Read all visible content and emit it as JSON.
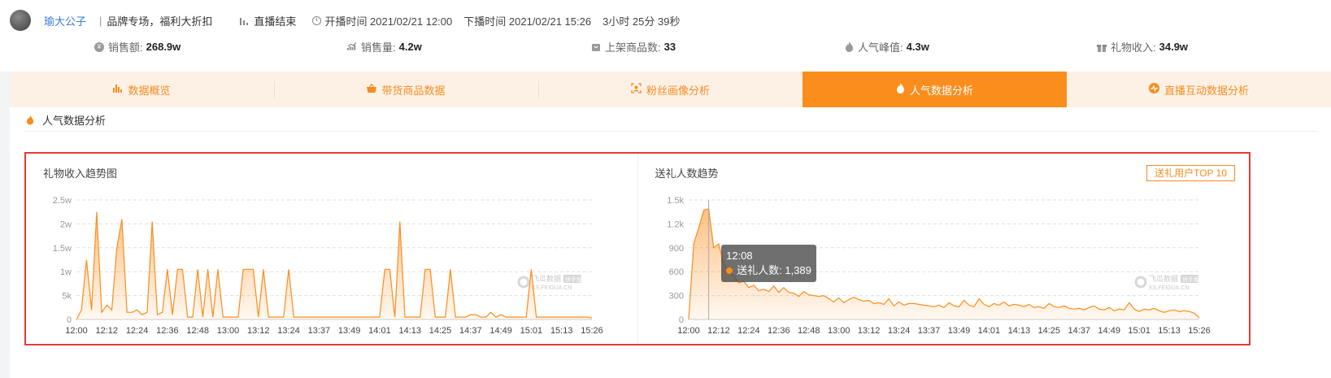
{
  "header": {
    "streamer_name": "瑜大公子",
    "title": "品牌专场，福利大折扣",
    "status": "直播结束",
    "start_label": "开播时间 2021/02/21 12:00",
    "end_label": "下播时间 2021/02/21 15:26",
    "duration": "3小时 25分 39秒"
  },
  "stats": [
    {
      "icon": "coin-icon",
      "label": "销售额:",
      "value": "268.9w"
    },
    {
      "icon": "trend-icon",
      "label": "销售量:",
      "value": "4.2w"
    },
    {
      "icon": "shop-bag-icon",
      "label": "上架商品数:",
      "value": "33"
    },
    {
      "icon": "flame-icon",
      "label": "人气峰值:",
      "value": "4.3w"
    },
    {
      "icon": "gift-icon",
      "label": "礼物收入:",
      "value": "34.9w"
    }
  ],
  "tabs": [
    {
      "icon": "bar-chart-icon",
      "label": "数据概览",
      "active": false
    },
    {
      "icon": "basket-icon",
      "label": "带货商品数据",
      "active": false
    },
    {
      "icon": "user-frame-icon",
      "label": "粉丝画像分析",
      "active": false
    },
    {
      "icon": "flame-icon",
      "label": "人气数据分析",
      "active": true
    },
    {
      "icon": "pulse-icon",
      "label": "直播互动数据分析",
      "active": false
    }
  ],
  "section_title": "人气数据分析",
  "colors": {
    "accent": "#fb8d1d",
    "tab_bg": "#fdf1e6",
    "highlight_border": "#e53935",
    "link": "#3a7bd5"
  },
  "watermark": {
    "brand": "飞瓜数据",
    "tag": "快手版",
    "url": "KS.FEIGUA.CN"
  },
  "gift_chart": {
    "title": "礼物收入趋势图",
    "yticks": [
      "0",
      "5k",
      "1w",
      "1.5w",
      "2w",
      "2.5w"
    ],
    "xticks": [
      "12:00",
      "12:12",
      "12:24",
      "12:36",
      "12:48",
      "13:00",
      "13:12",
      "13:24",
      "13:37",
      "13:49",
      "14:01",
      "14:13",
      "14:25",
      "14:37",
      "14:49",
      "15:01",
      "15:13",
      "15:26"
    ]
  },
  "giver_chart": {
    "title": "送礼人数趋势",
    "top10_button": "送礼用户TOP 10",
    "yticks": [
      "0",
      "300",
      "600",
      "900",
      "1.2k",
      "1.5k"
    ],
    "xticks": [
      "12:00",
      "12:12",
      "12:24",
      "12:36",
      "12:48",
      "13:00",
      "13:12",
      "13:24",
      "13:37",
      "13:49",
      "14:01",
      "14:13",
      "14:25",
      "14:37",
      "14:49",
      "15:01",
      "15:13",
      "15:26"
    ],
    "tooltip_time": "12:08",
    "tooltip_label": "送礼人数: 1,389"
  },
  "chart_data": [
    {
      "type": "area",
      "title": "礼物收入趋势图",
      "ylim": [
        0,
        25000
      ],
      "grid": true,
      "x": [
        "12:00",
        "12:02",
        "12:04",
        "12:06",
        "12:08",
        "12:10",
        "12:12",
        "12:14",
        "12:16",
        "12:18",
        "12:20",
        "12:22",
        "12:24",
        "12:26",
        "12:28",
        "12:30",
        "12:32",
        "12:34",
        "12:36",
        "12:38",
        "12:40",
        "12:42",
        "12:44",
        "12:46",
        "12:48",
        "12:50",
        "12:52",
        "12:54",
        "12:56",
        "12:58",
        "13:00",
        "13:02",
        "13:04",
        "13:06",
        "13:08",
        "13:10",
        "13:12",
        "13:14",
        "13:16",
        "13:18",
        "13:20",
        "13:22",
        "13:24",
        "13:26",
        "13:28",
        "13:30",
        "13:32",
        "13:34",
        "13:37",
        "13:39",
        "13:41",
        "13:43",
        "13:45",
        "13:47",
        "13:49",
        "13:51",
        "13:53",
        "13:55",
        "13:57",
        "13:59",
        "14:01",
        "14:03",
        "14:05",
        "14:07",
        "14:09",
        "14:11",
        "14:13",
        "14:15",
        "14:17",
        "14:19",
        "14:21",
        "14:23",
        "14:25",
        "14:27",
        "14:29",
        "14:31",
        "14:33",
        "14:35",
        "14:37",
        "14:39",
        "14:41",
        "14:43",
        "14:45",
        "14:47",
        "14:49",
        "14:51",
        "14:53",
        "14:55",
        "14:57",
        "14:59",
        "15:01",
        "15:03",
        "15:05",
        "15:07",
        "15:09",
        "15:11",
        "15:13",
        "15:15",
        "15:17",
        "15:19",
        "15:21",
        "15:23",
        "15:26"
      ],
      "values": [
        0,
        2000,
        12500,
        2000,
        22500,
        1500,
        3000,
        2000,
        15000,
        21000,
        1500,
        1500,
        2000,
        1000,
        1500,
        20500,
        1000,
        1500,
        10500,
        1000,
        10500,
        10500,
        500,
        500,
        10500,
        500,
        10500,
        500,
        10500,
        500,
        500,
        500,
        500,
        10500,
        10500,
        10500,
        500,
        10500,
        500,
        500,
        500,
        500,
        10500,
        500,
        500,
        500,
        500,
        500,
        500,
        500,
        500,
        500,
        500,
        500,
        500,
        500,
        500,
        500,
        500,
        500,
        500,
        10500,
        10500,
        500,
        20500,
        500,
        500,
        500,
        500,
        10500,
        10500,
        500,
        500,
        500,
        10500,
        500,
        500,
        500,
        1000,
        1000,
        500,
        500,
        1500,
        500,
        1000,
        500,
        500,
        500,
        500,
        500,
        10500,
        500,
        500,
        500,
        500,
        500,
        500,
        500,
        500,
        500,
        500,
        500,
        300
      ]
    },
    {
      "type": "area",
      "title": "送礼人数趋势",
      "ylim": [
        0,
        1500
      ],
      "grid": true,
      "x": [
        "12:00",
        "12:02",
        "12:04",
        "12:06",
        "12:08",
        "12:10",
        "12:12",
        "12:14",
        "12:16",
        "12:18",
        "12:20",
        "12:22",
        "12:24",
        "12:26",
        "12:28",
        "12:30",
        "12:32",
        "12:34",
        "12:36",
        "12:38",
        "12:40",
        "12:42",
        "12:44",
        "12:46",
        "12:48",
        "12:50",
        "12:52",
        "12:54",
        "12:56",
        "12:58",
        "13:00",
        "13:02",
        "13:04",
        "13:06",
        "13:08",
        "13:10",
        "13:12",
        "13:14",
        "13:16",
        "13:18",
        "13:20",
        "13:22",
        "13:24",
        "13:26",
        "13:28",
        "13:30",
        "13:32",
        "13:34",
        "13:37",
        "13:39",
        "13:41",
        "13:43",
        "13:45",
        "13:47",
        "13:49",
        "13:51",
        "13:53",
        "13:55",
        "13:57",
        "13:59",
        "14:01",
        "14:03",
        "14:05",
        "14:07",
        "14:09",
        "14:11",
        "14:13",
        "14:15",
        "14:17",
        "14:19",
        "14:21",
        "14:23",
        "14:25",
        "14:27",
        "14:29",
        "14:31",
        "14:33",
        "14:35",
        "14:37",
        "14:39",
        "14:41",
        "14:43",
        "14:45",
        "14:47",
        "14:49",
        "14:51",
        "14:53",
        "14:55",
        "14:57",
        "14:59",
        "15:01",
        "15:03",
        "15:05",
        "15:07",
        "15:09",
        "15:11",
        "15:13",
        "15:15",
        "15:17",
        "15:19",
        "15:21",
        "15:23",
        "15:26"
      ],
      "values": [
        0,
        950,
        1150,
        1370,
        1389,
        900,
        950,
        700,
        600,
        550,
        460,
        480,
        400,
        430,
        360,
        380,
        350,
        420,
        340,
        400,
        340,
        330,
        290,
        350,
        310,
        300,
        290,
        300,
        260,
        220,
        270,
        210,
        250,
        280,
        250,
        230,
        240,
        200,
        210,
        190,
        260,
        170,
        220,
        180,
        200,
        200,
        190,
        180,
        170,
        160,
        180,
        150,
        210,
        170,
        160,
        240,
        180,
        160,
        260,
        190,
        160,
        200,
        180,
        220,
        170,
        190,
        180,
        160,
        190,
        150,
        160,
        140,
        200,
        160,
        150,
        170,
        140,
        130,
        140,
        120,
        150,
        170,
        130,
        120,
        150,
        110,
        130,
        120,
        210,
        130,
        100,
        130,
        120,
        140,
        110,
        90,
        110,
        120,
        100,
        110,
        100,
        80,
        20
      ]
    }
  ]
}
